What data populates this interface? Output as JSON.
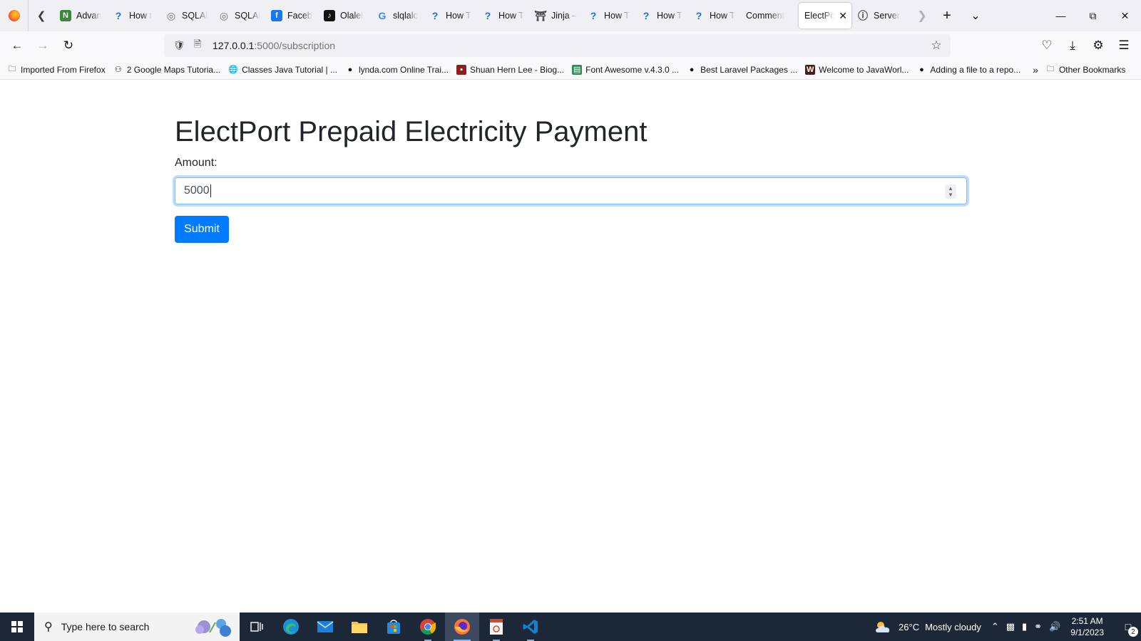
{
  "browser": {
    "tabs": [
      {
        "label": "Advan",
        "icon": "nodejs-icon",
        "color": "#3c873a",
        "glyph": "N"
      },
      {
        "label": "How t",
        "icon": "faq-icon",
        "color": "#1f6fd1",
        "glyph": "?"
      },
      {
        "label": "SQLAl",
        "icon": "sqlalchemy-icon",
        "color": "#6e6e6e",
        "glyph": "◎"
      },
      {
        "label": "SQLAl",
        "icon": "sqlalchemy-icon",
        "color": "#6e6e6e",
        "glyph": "◎"
      },
      {
        "label": "Faceb",
        "icon": "facebook-icon",
        "color": "#1877f2",
        "glyph": "f"
      },
      {
        "label": "Olalel",
        "icon": "tiktok-icon",
        "color": "#111111",
        "glyph": "♪"
      },
      {
        "label": "slqlalc",
        "icon": "google-icon",
        "color": "#4285f4",
        "glyph": "G"
      },
      {
        "label": "How T",
        "icon": "faq-icon",
        "color": "#1f6fd1",
        "glyph": "?"
      },
      {
        "label": "How T",
        "icon": "faq-icon",
        "color": "#1f6fd1",
        "glyph": "?"
      },
      {
        "label": "Jinja –",
        "icon": "jinja-icon",
        "color": "#444444",
        "glyph": "⛩"
      },
      {
        "label": "How T",
        "icon": "faq-icon",
        "color": "#1f6fd1",
        "glyph": "?"
      },
      {
        "label": "How T",
        "icon": "faq-icon",
        "color": "#1f6fd1",
        "glyph": "?"
      },
      {
        "label": "How T",
        "icon": "faq-icon",
        "color": "#1f6fd1",
        "glyph": "?"
      },
      {
        "label": "Comment",
        "icon": "",
        "color": "",
        "glyph": ""
      },
      {
        "label": "ElectPo",
        "icon": "",
        "color": "",
        "glyph": "",
        "active": true
      },
      {
        "label": "Server",
        "icon": "info-icon",
        "color": "#3b3b45",
        "glyph": "ⓘ"
      }
    ],
    "url_host": "127.0.0.1",
    "url_path": ":5000/subscription",
    "bookmarks": [
      {
        "label": "Imported From Firefox",
        "icon": "folder-icon",
        "glyph": "🗀",
        "color": "transparent"
      },
      {
        "label": "2 Google Maps Tutoria...",
        "icon": "people-icon",
        "glyph": "⚇",
        "color": "transparent"
      },
      {
        "label": "Classes Java Tutorial | ...",
        "icon": "globe-icon",
        "glyph": "🌐",
        "color": "transparent"
      },
      {
        "label": "lynda.com Online Trai...",
        "icon": "lynda-icon",
        "glyph": "●",
        "color": "transparent"
      },
      {
        "label": "Shuan Hern Lee - Biog...",
        "icon": "portrait-icon",
        "glyph": "▪",
        "color": "#8b1e1e"
      },
      {
        "label": "Font Awesome v.4.3.0 ...",
        "icon": "font-awesome-icon",
        "glyph": "▤",
        "color": "#2e8b57"
      },
      {
        "label": "Best Laravel Packages ...",
        "icon": "laravel-icon",
        "glyph": "●",
        "color": "transparent"
      },
      {
        "label": "Welcome to JavaWorl...",
        "icon": "javaworld-icon",
        "glyph": "W",
        "color": "#4b1c1c"
      },
      {
        "label": "Adding a file to a repo...",
        "icon": "github-icon",
        "glyph": "●",
        "color": "transparent"
      }
    ],
    "other_bookmarks": "Other Bookmarks"
  },
  "page": {
    "title": "ElectPort Prepaid Electricity Payment",
    "amount_label": "Amount:",
    "amount_value": "5000",
    "submit_label": "Submit"
  },
  "taskbar": {
    "search_placeholder": "Type here to search",
    "weather_temp": "26°C",
    "weather_desc": "Mostly cloudy",
    "time": "2:51 AM",
    "date": "9/1/2023",
    "notification_count": "2"
  },
  "colors": {
    "primary": "#007bff",
    "taskbar": "#1c2838"
  }
}
